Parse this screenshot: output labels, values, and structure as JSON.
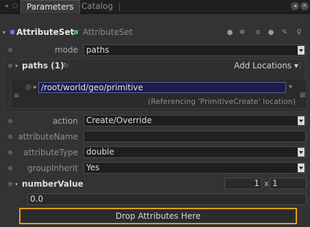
{
  "tabs": [
    {
      "label": "Parameters",
      "active": true
    },
    {
      "label": "Catalog",
      "active": false
    }
  ],
  "node": {
    "name": "AttributeSet",
    "type": "AttributeSet",
    "accent_left": "#6b7bd8",
    "accent_right": "#4caf50"
  },
  "params": {
    "mode": {
      "label": "mode",
      "value": "paths"
    },
    "paths_group": {
      "label": "paths (1)",
      "add_locations": "Add Locations"
    },
    "path_entry": {
      "value": "/root/world/geo/primitive",
      "note": "(Referencing 'PrimitiveCreate' location)"
    },
    "action": {
      "label": "action",
      "value": "Create/Override"
    },
    "attributeName": {
      "label": "attributeName",
      "value": ""
    },
    "attributeType": {
      "label": "attributeType",
      "value": "double"
    },
    "groupInherit": {
      "label": "groupInherit",
      "value": "Yes"
    },
    "numberValue": {
      "label": "numberValue",
      "rows": "1",
      "x": "x",
      "cols": "1",
      "value": "0.0"
    }
  },
  "drop_zone": {
    "label": "Drop Attributes Here"
  },
  "colors": {
    "drop_border": "#e6a21f",
    "path_bg": "#1b1d4a"
  }
}
